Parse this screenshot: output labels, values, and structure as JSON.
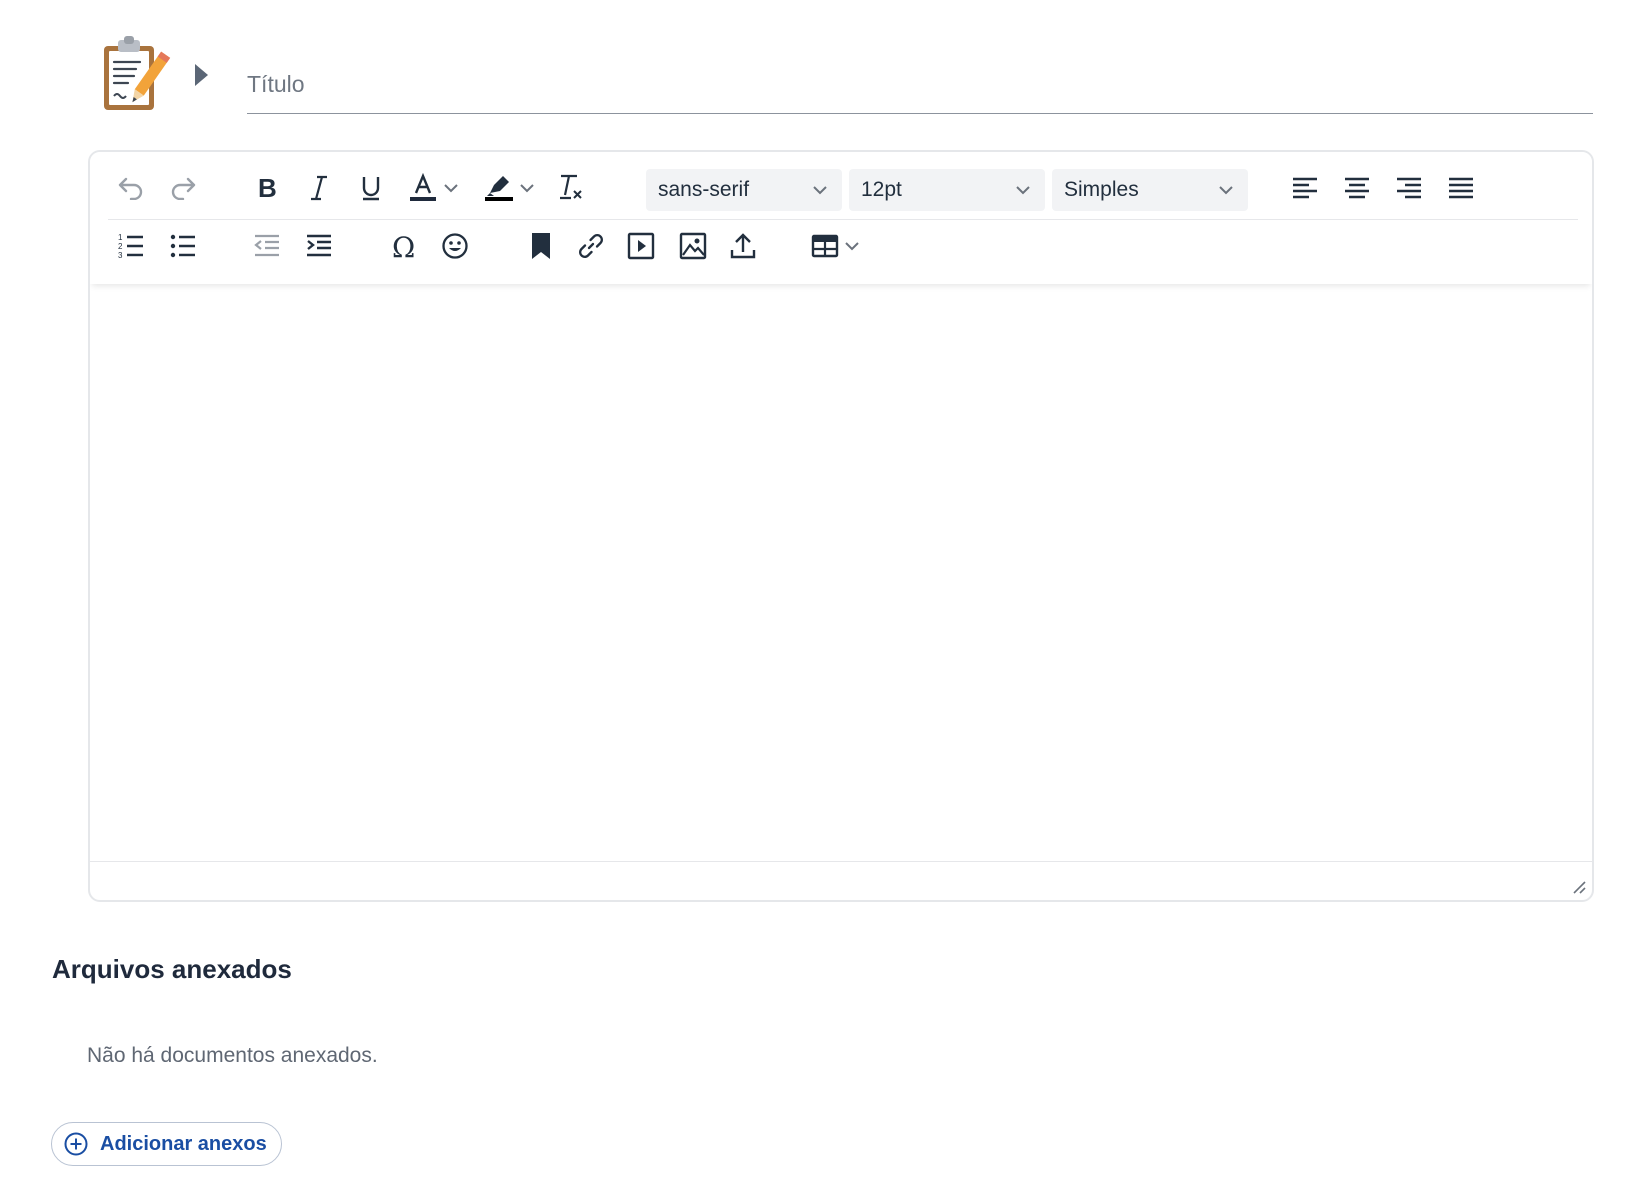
{
  "title_field": {
    "placeholder": "Título"
  },
  "toolbar": {
    "font_family": "sans-serif",
    "font_size": "12pt",
    "block_format": "Simples",
    "text_color": "#1f2a3c",
    "highlight_color": "#000000"
  },
  "attachments": {
    "heading": "Arquivos anexados",
    "empty_message": "Não há documentos anexados.",
    "add_button_label": "Adicionar anexos",
    "accent": "#1a4ea3"
  }
}
